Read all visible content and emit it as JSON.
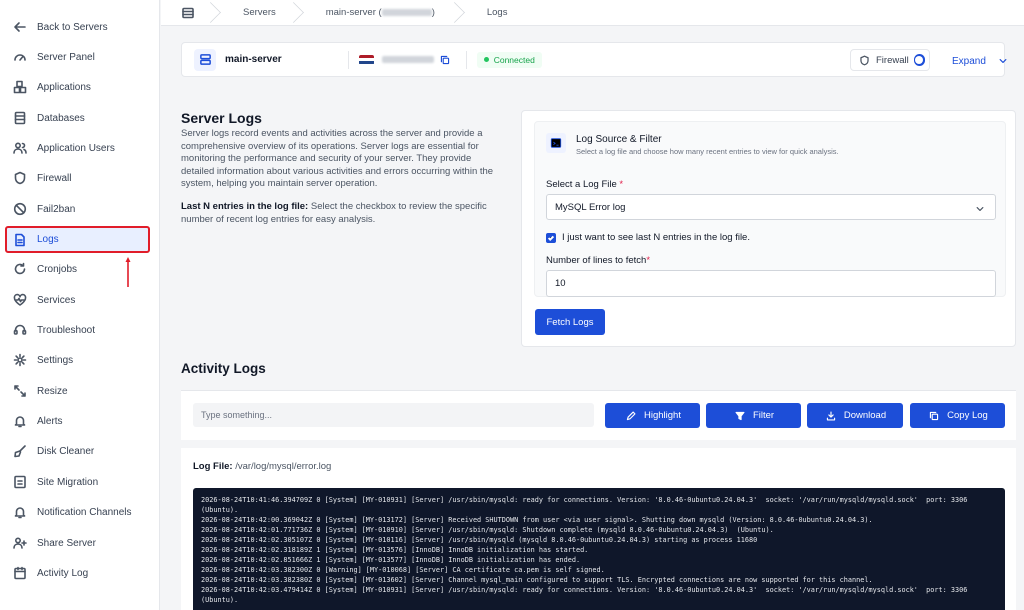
{
  "sidebar": {
    "items": [
      {
        "label": "Back to Servers",
        "icon": "arrow-left-icon"
      },
      {
        "label": "Server Panel",
        "icon": "gauge-icon"
      },
      {
        "label": "Applications",
        "icon": "cubes-icon"
      },
      {
        "label": "Databases",
        "icon": "database-icon"
      },
      {
        "label": "Application Users",
        "icon": "users-icon"
      },
      {
        "label": "Firewall",
        "icon": "shield-icon"
      },
      {
        "label": "Fail2ban",
        "icon": "ban-icon"
      },
      {
        "label": "Logs",
        "icon": "file-icon",
        "active": true
      },
      {
        "label": "Cronjobs",
        "icon": "refresh-icon"
      },
      {
        "label": "Services",
        "icon": "heart-pulse-icon"
      },
      {
        "label": "Troubleshoot",
        "icon": "headset-icon"
      },
      {
        "label": "Settings",
        "icon": "gear-icon"
      },
      {
        "label": "Resize",
        "icon": "resize-icon"
      },
      {
        "label": "Alerts",
        "icon": "bell-icon"
      },
      {
        "label": "Disk Cleaner",
        "icon": "broom-icon"
      },
      {
        "label": "Site Migration",
        "icon": "migration-icon"
      },
      {
        "label": "Notification Channels",
        "icon": "bell-outline-icon"
      },
      {
        "label": "Share Server",
        "icon": "share-icon"
      },
      {
        "label": "Activity Log",
        "icon": "calendar-icon"
      }
    ]
  },
  "breadcrumb": {
    "items": [
      "Servers",
      "main-server (",
      ")",
      "Logs"
    ]
  },
  "server": {
    "name": "main-server",
    "status": "Connected",
    "firewall_label": "Firewall",
    "firewall_on": true,
    "expand_label": "Expand"
  },
  "page": {
    "title": "Server Logs",
    "description": "Server logs record events and activities across the server and provide a comprehensive overview of its operations. Server logs are essential for monitoring the performance and security of your server. They provide detailed information about various activities and errors occurring within the system, helping you maintain server operation.",
    "lastn_bold": "Last N entries in the log file:",
    "lastn_text": " Select the checkbox to review the specific number of recent log entries for easy analysis."
  },
  "filter": {
    "title": "Log Source & Filter",
    "subtitle": "Select a log file and choose how many recent entries to view for quick analysis.",
    "file_label": "Select a Log File",
    "file_value": "MySQL Error log",
    "checkbox_label": "I just want to see last N entries in the log file.",
    "checkbox_checked": true,
    "lines_label": "Number of lines to fetch",
    "lines_value": "10",
    "fetch_button": "Fetch Logs"
  },
  "activity": {
    "title": "Activity Logs",
    "search_placeholder": "Type something...",
    "buttons": {
      "highlight": "Highlight",
      "filter": "Filter",
      "download": "Download",
      "copy": "Copy Log"
    },
    "log_file_label": "Log File:",
    "log_file_path": "/var/log/mysql/error.log",
    "lines": [
      "2026-08-24T10:41:46.394709Z 0 [System] [MY-010931] [Server] /usr/sbin/mysqld: ready for connections. Version: '8.0.46-0ubuntu0.24.04.3'  socket: '/var/run/mysqld/mysqld.sock'  port: 3306",
      "(Ubuntu).",
      "2026-08-24T10:42:00.369042Z 0 [System] [MY-013172] [Server] Received SHUTDOWN from user <via user signal>. Shutting down mysqld (Version: 8.0.46-0ubuntu0.24.04.3).",
      "2026-08-24T10:42:01.771736Z 0 [System] [MY-010910] [Server] /usr/sbin/mysqld: Shutdown complete (mysqld 8.0.46-0ubuntu0.24.04.3)  (Ubuntu).",
      "2026-08-24T10:42:02.305107Z 0 [System] [MY-010116] [Server] /usr/sbin/mysqld (mysqld 8.0.46-0ubuntu0.24.04.3) starting as process 11680",
      "2026-08-24T10:42:02.318189Z 1 [System] [MY-013576] [InnoDB] InnoDB initialization has started.",
      "2026-08-24T10:42:02.851666Z 1 [System] [MY-013577] [InnoDB] InnoDB initialization has ended.",
      "2026-08-24T10:42:03.382300Z 0 [Warning] [MY-010068] [Server] CA certificate ca.pem is self signed.",
      "2026-08-24T10:42:03.382380Z 0 [System] [MY-013602] [Server] Channel mysql_main configured to support TLS. Encrypted connections are now supported for this channel.",
      "2026-08-24T10:42:03.479414Z 0 [System] [MY-010931] [Server] /usr/sbin/mysqld: ready for connections. Version: '8.0.46-0ubuntu0.24.04.3'  socket: '/var/run/mysqld/mysqld.sock'  port: 3306",
      "(Ubuntu)."
    ]
  },
  "colors": {
    "accent": "#1d4ed8",
    "highlight_border": "#e11d2a",
    "success": "#16a34a"
  }
}
